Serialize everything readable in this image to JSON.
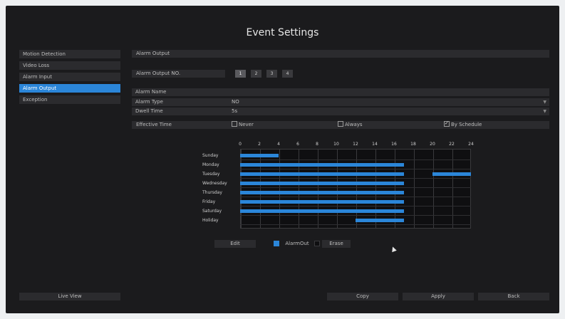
{
  "window": {
    "title": "Event Settings"
  },
  "sidebar": {
    "items": [
      {
        "label": "Motion Detection",
        "active": false
      },
      {
        "label": "Video Loss",
        "active": false
      },
      {
        "label": "Alarm Input",
        "active": false
      },
      {
        "label": "Alarm Output",
        "active": true
      },
      {
        "label": "Exception",
        "active": false
      }
    ],
    "live_view_label": "Live View"
  },
  "main": {
    "section_title": "Alarm Output",
    "output_no": {
      "label": "Alarm Output NO.",
      "options": [
        "1",
        "2",
        "3",
        "4"
      ],
      "selected": "1"
    },
    "fields": {
      "alarm_name": {
        "label": "Alarm Name",
        "value": ""
      },
      "alarm_type": {
        "label": "Alarm Type",
        "value": "NO"
      },
      "dwell_time": {
        "label": "Dwell Time",
        "value": "5s"
      }
    },
    "effective_time": {
      "label": "Effective Time",
      "options": [
        {
          "label": "Never",
          "checked": false
        },
        {
          "label": "Always",
          "checked": false
        },
        {
          "label": "By Schedule",
          "checked": true
        }
      ]
    },
    "schedule": {
      "hours": [
        "0",
        "2",
        "4",
        "6",
        "8",
        "10",
        "12",
        "14",
        "16",
        "18",
        "20",
        "22",
        "24"
      ],
      "days": [
        {
          "label": "Sunday",
          "ranges": [
            [
              0,
              4
            ]
          ]
        },
        {
          "label": "Monday",
          "ranges": [
            [
              0,
              17
            ]
          ]
        },
        {
          "label": "Tuesday",
          "ranges": [
            [
              0,
              17
            ],
            [
              20,
              24
            ]
          ]
        },
        {
          "label": "Wednesday",
          "ranges": [
            [
              0,
              17
            ]
          ]
        },
        {
          "label": "Thursday",
          "ranges": [
            [
              0,
              17
            ]
          ]
        },
        {
          "label": "Friday",
          "ranges": [
            [
              0,
              17
            ]
          ]
        },
        {
          "label": "Saturday",
          "ranges": [
            [
              0,
              17
            ]
          ]
        },
        {
          "label": "Holiday",
          "ranges": [
            [
              12,
              17
            ]
          ]
        }
      ]
    },
    "tools": {
      "edit_label": "Edit",
      "alarm_out_label": "AlarmOut",
      "erase_label": "Erase"
    },
    "footer": {
      "copy_label": "Copy",
      "apply_label": "Apply",
      "back_label": "Back"
    }
  },
  "colors": {
    "accent": "#2b86d9",
    "panel": "#2b2b2e",
    "background": "#1b1b1d"
  }
}
